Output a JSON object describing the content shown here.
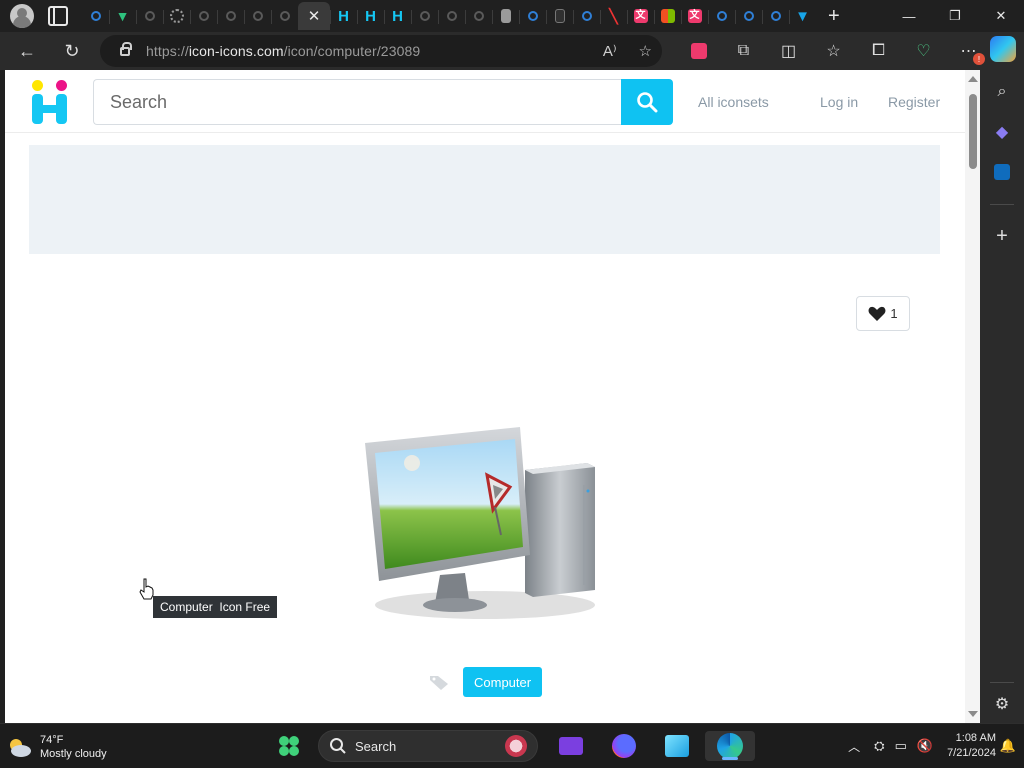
{
  "browser": {
    "url_prefix": "https://",
    "url_domain": "icon-icons.com",
    "url_path": "/icon/computer/23089",
    "more_badge": "!"
  },
  "site": {
    "search_placeholder": "Search",
    "nav": {
      "all_iconsets": "All iconsets",
      "login": "Log in",
      "register": "Register"
    },
    "like_count": "1",
    "tooltip": "Computer  Icon Free",
    "tag": "Computer"
  },
  "taskbar": {
    "temperature": "74°F",
    "condition": "Mostly cloudy",
    "search_label": "Search",
    "time": "1:08 AM",
    "date": "7/21/2024"
  },
  "colors": {
    "accent": "#0fc2f2",
    "logo_yellow": "#ffe600",
    "logo_pink": "#ec1387",
    "logo_cyan": "#15c7f3"
  }
}
